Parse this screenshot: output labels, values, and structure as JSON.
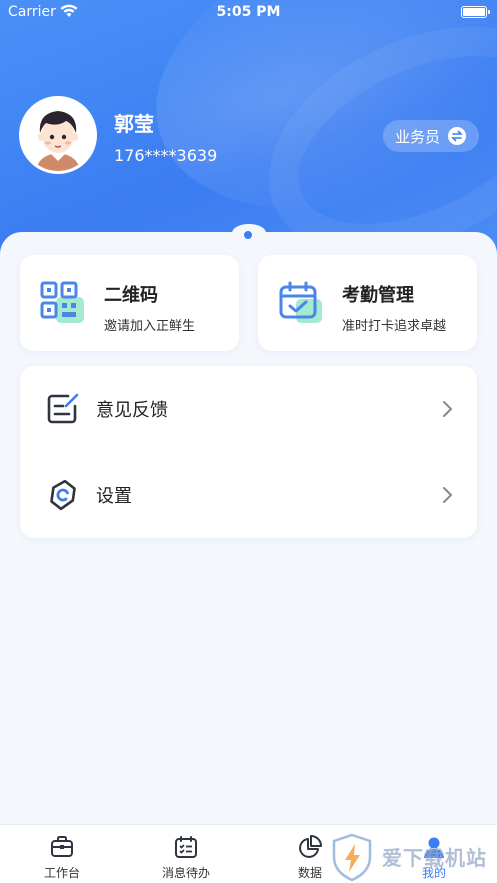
{
  "status_bar": {
    "carrier": "Carrier",
    "time": "5:05 PM"
  },
  "profile": {
    "name": "郭莹",
    "phone": "176****3639",
    "role": "业务员"
  },
  "cards": {
    "qr": {
      "title": "二维码",
      "subtitle": "邀请加入正鲜生"
    },
    "attendance": {
      "title": "考勤管理",
      "subtitle": "准时打卡追求卓越"
    }
  },
  "menu": {
    "feedback": "意见反馈",
    "settings": "设置"
  },
  "tabbar": {
    "items": [
      {
        "label": "工作台",
        "icon": "briefcase-icon"
      },
      {
        "label": "消息待办",
        "icon": "calendar-list-icon"
      },
      {
        "label": "数据",
        "icon": "pie-chart-icon"
      },
      {
        "label": "我的",
        "icon": "user-icon",
        "active": true
      }
    ]
  },
  "watermark": {
    "text": "爱下载机站"
  },
  "colors": {
    "primary": "#3b7df2",
    "background": "#f4f7fc"
  }
}
